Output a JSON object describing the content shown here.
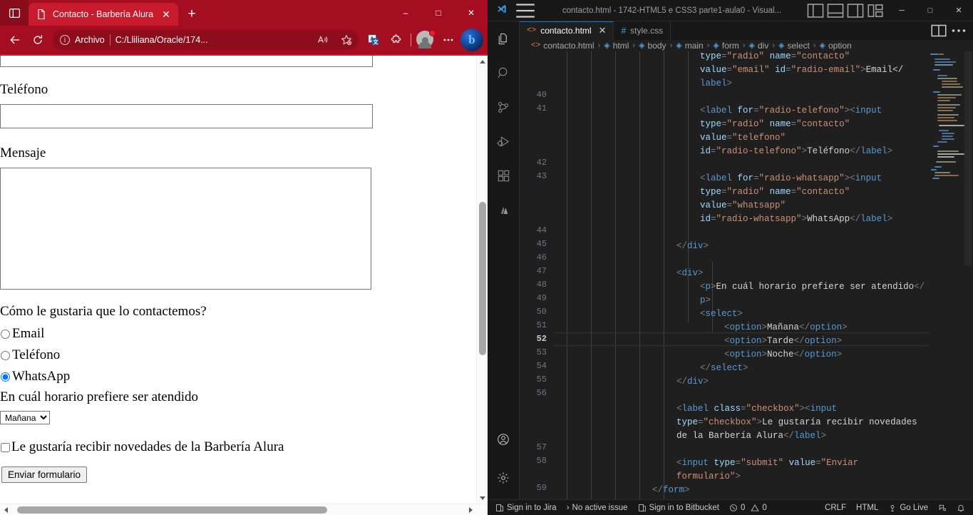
{
  "browser": {
    "tab": {
      "title": "Contacto - Barbería Alura",
      "favicon_icon": "page-icon",
      "close_icon": "close-icon"
    },
    "tab_search_icon": "tab-search-icon",
    "new_tab_label": "+",
    "window_controls": {
      "minimize": "–",
      "maximize": "□",
      "close": "✕"
    },
    "toolbar": {
      "back_icon": "back-arrow-icon",
      "refresh_icon": "refresh-icon",
      "omnibox": {
        "info_icon": "info-icon",
        "scheme_label": "Archivo",
        "url": "C:/Lliliana/Oracle/174...",
        "read_aloud_icon": "read-aloud-icon",
        "favorite_icon": "add-favorite-icon"
      },
      "translate_icon": "translate-icon",
      "extensions_icon": "extensions-icon",
      "profile_icon": "profile-avatar-icon",
      "settings_icon": "more-options-icon",
      "copilot_icon": "bing-copilot-icon",
      "copilot_glyph": "b"
    },
    "page": {
      "telefono_label": "Teléfono",
      "telefono_value": "",
      "mensaje_label": "Mensaje",
      "mensaje_value": "",
      "contact_question": "Cómo le gustaria que lo contactemos?",
      "radios": [
        {
          "label": "Email",
          "value": "email",
          "checked": false
        },
        {
          "label": "Teléfono",
          "value": "telefono",
          "checked": false
        },
        {
          "label": "WhatsApp",
          "value": "whatsapp",
          "checked": true
        }
      ],
      "horario_question": "En cuál horario prefiere ser atendido",
      "horario_selected": "Mañana",
      "horario_options": [
        "Mañana",
        "Tarde",
        "Noche"
      ],
      "newsletter_label": "Le gustaría recibir novedades de la Barbería Alura",
      "newsletter_checked": false,
      "submit_label": "Enviar formulario"
    }
  },
  "vscode": {
    "titlebar": {
      "title": "contacto.html - 1742-HTML5 e CSS3 parte1-aula0 - Visual...",
      "logo_icon": "vscode-logo-icon",
      "menu_icon": "hamburger-menu-icon",
      "layout_icons": [
        "toggle-primary-sidebar-icon",
        "toggle-panel-icon",
        "toggle-secondary-sidebar-icon",
        "customize-layout-icon"
      ],
      "window_controls": {
        "minimize": "─",
        "maximize": "□",
        "close": "✕"
      }
    },
    "activity_bar": {
      "items": [
        {
          "name": "explorer-icon",
          "label": "Explorer"
        },
        {
          "name": "search-icon",
          "label": "Search"
        },
        {
          "name": "source-control-icon",
          "label": "Source Control"
        },
        {
          "name": "run-debug-icon",
          "label": "Run and Debug"
        },
        {
          "name": "extensions-icon",
          "label": "Extensions"
        },
        {
          "name": "atlassian-icon",
          "label": "Atlassian"
        }
      ],
      "bottom_items": [
        {
          "name": "account-icon",
          "label": "Accounts"
        },
        {
          "name": "settings-gear-icon",
          "label": "Manage"
        }
      ]
    },
    "tabs": [
      {
        "label": "contacto.html",
        "icon": "html-file-icon",
        "active": true,
        "close_icon": "close-icon"
      },
      {
        "label": "style.css",
        "icon": "css-file-icon",
        "active": false
      }
    ],
    "tabs_actions": [
      "split-editor-icon",
      "more-actions-icon"
    ],
    "breadcrumb": [
      {
        "label": "contacto.html",
        "icon": "html-file-icon"
      },
      {
        "label": "html",
        "icon": "symbol-tag-icon"
      },
      {
        "label": "body",
        "icon": "symbol-tag-icon"
      },
      {
        "label": "main",
        "icon": "symbol-tag-icon"
      },
      {
        "label": "form",
        "icon": "symbol-tag-icon"
      },
      {
        "label": "div",
        "icon": "symbol-tag-icon"
      },
      {
        "label": "select",
        "icon": "symbol-tag-icon"
      },
      {
        "label": "option",
        "icon": "symbol-tag-icon"
      }
    ],
    "breadcrumb_separator": "›",
    "editor": {
      "current_line": 52,
      "visible_line_numbers": [
        "40",
        "41",
        "42",
        "43",
        "44",
        "45",
        "46",
        "47",
        "48",
        "49",
        "50",
        "51",
        "52",
        "53",
        "54",
        "55",
        "56",
        "57",
        "58",
        "59"
      ],
      "code_lines": [
        "type=\"radio\" name=\"contacto\"",
        "value=\"email\" id=\"radio-email\">Email</",
        "label>",
        "",
        "<label for=\"radio-telefono\"><input",
        "type=\"radio\" name=\"contacto\"",
        "value=\"telefono\"",
        "id=\"radio-telefono\">Teléfono</label>",
        "",
        "<label for=\"radio-whatsapp\"><input",
        "type=\"radio\" name=\"contacto\"",
        "value=\"whatsapp\"",
        "id=\"radio-whatsapp\">WhatsApp</label>",
        "",
        "</div>",
        "",
        "<div>",
        "<p>En cuál horario prefiere ser atendido</",
        "p>",
        "<select>",
        "<option>Mañana</option>",
        "<option>Tarde</option>",
        "<option>Noche</option>",
        "</select>",
        "</div>",
        "",
        "<label class=\"checkbox\"><input",
        "type=\"checkbox\">Le gustaría recibir novedades",
        "de la Barbería Alura</label>",
        "",
        "<input type=\"submit\" value=\"Enviar",
        "formulario\">",
        "</form>"
      ]
    },
    "status_bar": {
      "jira": "Sign in to Jira",
      "issue": "No active issue",
      "bitbucket": "Sign in to Bitbucket",
      "errors": "0",
      "warnings": "0",
      "eol": "CRLF",
      "language": "HTML",
      "golive": "Go Live",
      "error_icon": "error-circle-icon",
      "warning_icon": "warning-triangle-icon",
      "jira_icon": "jira-icon",
      "bitbucket_icon": "bitbucket-icon",
      "issue_icon": "chevron-right-icon",
      "golive_icon": "broadcast-icon",
      "remote_icon": "remote-icon",
      "bell_icon": "bell-icon"
    }
  },
  "colors": {
    "browser_chrome": "#a50e20",
    "browser_tab_active": "#c81b2e",
    "vscode_bg": "#1f1f1f",
    "vscode_titlebar": "#181818",
    "accent_blue": "#0078d4"
  }
}
